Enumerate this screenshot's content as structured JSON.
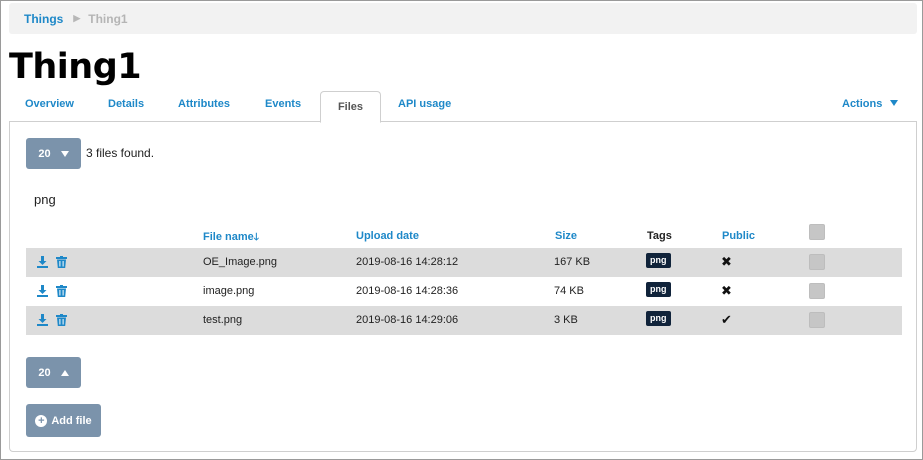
{
  "breadcrumb": {
    "items": [
      {
        "label": "Things"
      },
      {
        "label": "Thing1"
      }
    ],
    "separator": "▶"
  },
  "page": {
    "title": "Thing1"
  },
  "tabs": [
    {
      "label": "Overview",
      "active": false
    },
    {
      "label": "Details",
      "active": false
    },
    {
      "label": "Attributes",
      "active": false
    },
    {
      "label": "Events",
      "active": false
    },
    {
      "label": "Files",
      "active": true
    },
    {
      "label": "API usage",
      "active": false
    }
  ],
  "actions": {
    "label": "Actions"
  },
  "toolbar": {
    "page_size": "20",
    "files_found": "3 files found."
  },
  "filter": {
    "label": "png"
  },
  "table": {
    "columns": [
      "File name",
      "Upload date",
      "Size",
      "Tags",
      "Public"
    ],
    "sort_column": "File name",
    "sort_icon": "arrow-down-icon",
    "rows": [
      {
        "name": "OE_Image.png",
        "date": "2019-08-16 14:28:12",
        "size": "167 KB",
        "tag": "png",
        "public": false
      },
      {
        "name": "image.png",
        "date": "2019-08-16 14:28:36",
        "size": "74 KB",
        "tag": "png",
        "public": false
      },
      {
        "name": "test.png",
        "date": "2019-08-16 14:29:06",
        "size": "3 KB",
        "tag": "png",
        "public": true
      }
    ],
    "public_true_icon": "✔",
    "public_false_icon": "✖"
  },
  "pager_bottom": {
    "page_size": "20"
  },
  "add_file": {
    "label": "Add file"
  },
  "colors": {
    "link": "#1e88c8",
    "button": "#7b93ab",
    "tag_bg": "#10233a",
    "row_shade": "#dcdcdc"
  }
}
